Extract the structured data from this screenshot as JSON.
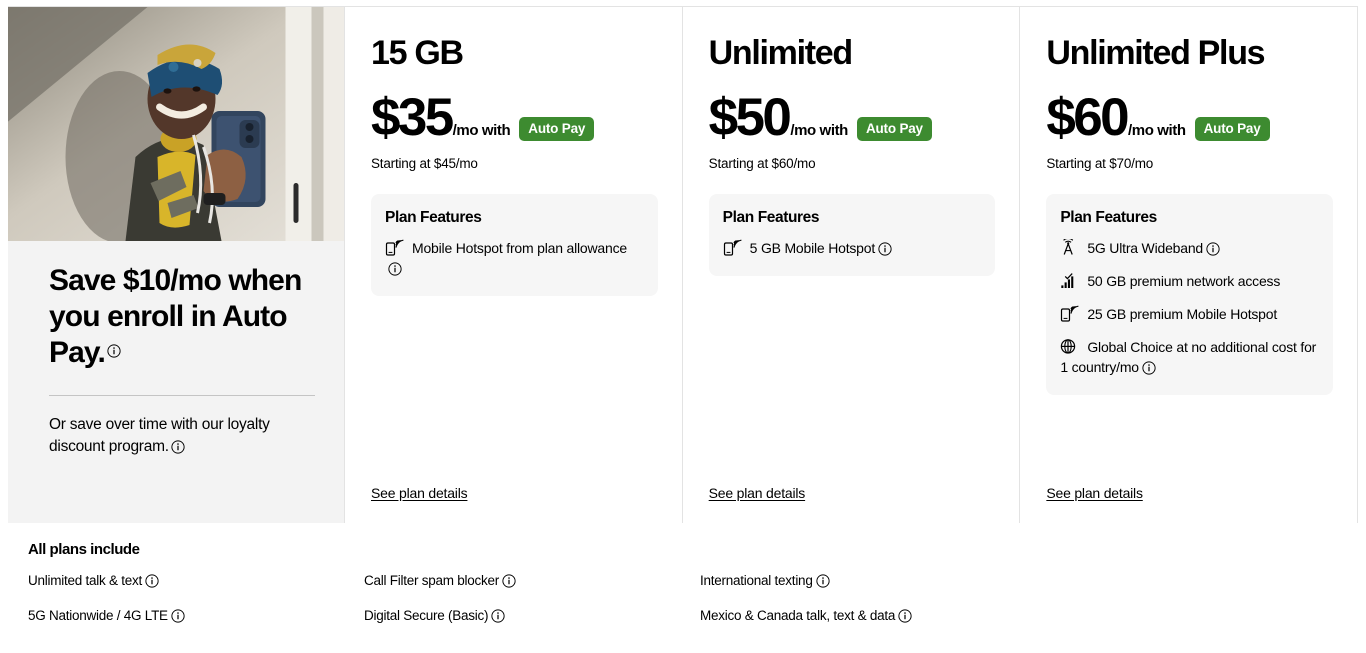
{
  "promo": {
    "headline": "Save $10/mo when you enroll in Auto Pay.",
    "subtext": "Or save over time with our loyalty discount program.",
    "photo_alt": "smiling-person-holding-phone"
  },
  "plans": [
    {
      "name": "15 GB",
      "price": "$35",
      "per": "/mo with",
      "badge": "Auto Pay",
      "starting_at": "Starting at $45/mo",
      "features_title": "Plan Features",
      "features": [
        {
          "icon": "mobile-hotspot-icon",
          "text": "Mobile Hotspot from plan allowance",
          "info": true
        }
      ],
      "details_link": "See plan details"
    },
    {
      "name": "Unlimited",
      "price": "$50",
      "per": "/mo with",
      "badge": "Auto Pay",
      "starting_at": "Starting at $60/mo",
      "features_title": "Plan Features",
      "features": [
        {
          "icon": "mobile-hotspot-icon",
          "text": "5 GB Mobile Hotspot",
          "info": true
        }
      ],
      "details_link": "See plan details"
    },
    {
      "name": "Unlimited Plus",
      "price": "$60",
      "per": "/mo with",
      "badge": "Auto Pay",
      "starting_at": "Starting at $70/mo",
      "features_title": "Plan Features",
      "features": [
        {
          "icon": "tower-5g-icon",
          "text": "5G Ultra Wideband",
          "info": true
        },
        {
          "icon": "signal-bars-icon",
          "text": "50 GB premium network access",
          "info": false
        },
        {
          "icon": "mobile-hotspot-icon",
          "text": "25 GB premium Mobile Hotspot",
          "info": false
        },
        {
          "icon": "globe-icon",
          "text": "Global Choice at no additional cost for 1 country/mo",
          "info": true
        }
      ],
      "details_link": "See plan details"
    }
  ],
  "all_plans": {
    "title": "All plans include",
    "columns": [
      [
        {
          "text": "Unlimited talk & text",
          "info": true
        },
        {
          "text": "5G Nationwide / 4G LTE",
          "info": true
        }
      ],
      [
        {
          "text": "Call Filter spam blocker",
          "info": true
        },
        {
          "text": "Digital Secure (Basic)",
          "info": true
        }
      ],
      [
        {
          "text": "International texting",
          "info": true
        },
        {
          "text": "Mexico & Canada talk, text & data",
          "info": true
        }
      ]
    ]
  },
  "colors": {
    "badge_green": "#3d8b30",
    "panel_gray": "#f3f3f3",
    "card_gray": "#f6f6f6",
    "divider": "#e3e3e3"
  }
}
